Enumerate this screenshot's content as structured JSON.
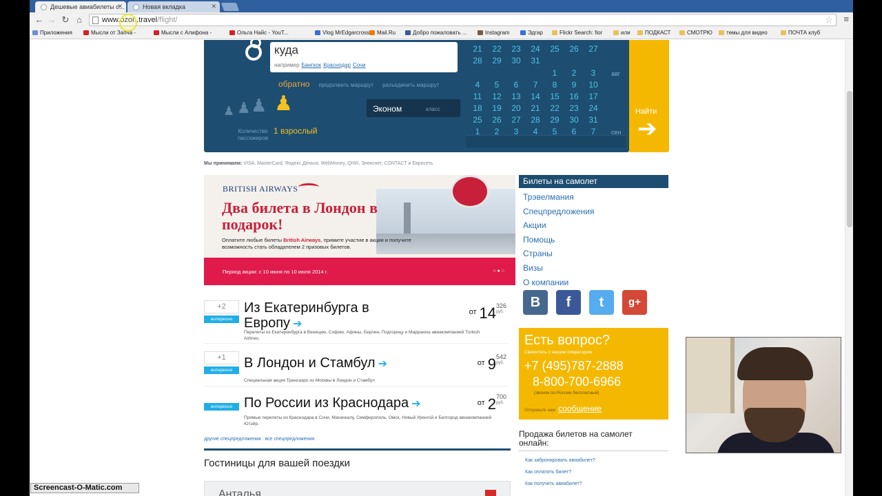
{
  "browser": {
    "tabs": [
      {
        "title": "Дешевые авиабилеты о...",
        "active": true
      },
      {
        "title": "Новая вкладка",
        "active": false
      }
    ],
    "url_host": "www.ozon.travel",
    "url_path": "/flight/",
    "bookmarks": [
      {
        "label": "Приложения",
        "icon": "apps"
      },
      {
        "label": "Мысли от Запча -",
        "icon": "yt"
      },
      {
        "label": "Мысли с Алифона -",
        "icon": "yt"
      },
      {
        "label": "Ольга Найс - YouT...",
        "icon": "yt"
      },
      {
        "label": "Vlog MrEdgarcross",
        "icon": "blue"
      },
      {
        "label": "Mail.Ru",
        "icon": "mail"
      },
      {
        "label": "Добро пожаловать ...",
        "icon": "fb"
      },
      {
        "label": "Instagram",
        "icon": "ig"
      },
      {
        "label": "Эдгар",
        "icon": "blue"
      },
      {
        "label": "Flickr Search: fior",
        "icon": "folder"
      },
      {
        "label": "или",
        "icon": "folder"
      },
      {
        "label": "ПОДКАСТ",
        "icon": "folder"
      },
      {
        "label": "СМОТРЮ",
        "icon": "folder"
      },
      {
        "label": "темы для видео",
        "icon": "folder"
      },
      {
        "label": "ПОЧТА клуб",
        "icon": "folder"
      }
    ]
  },
  "search": {
    "destination_placeholder": "куда",
    "hint_prefix": "например",
    "hint_examples": [
      "Бангкок",
      "Краснодар",
      "Сочи"
    ],
    "return_label": "обратно",
    "extend_route": "продолжить маршрут",
    "split_route": "разъединить маршрут",
    "passengers_label": "Количество пассажиров",
    "passengers_count": "1 взрослый",
    "class_value": "Эконом",
    "class_label": "класс",
    "find_label": "Найти",
    "calendar": {
      "rows": [
        [
          "21",
          "22",
          "23",
          "24",
          "25",
          "26",
          "27"
        ],
        [
          "28",
          "29",
          "30",
          "31",
          "",
          "",
          ""
        ],
        [
          "",
          "",
          "",
          "",
          "1",
          "2",
          "3"
        ],
        [
          "4",
          "5",
          "6",
          "7",
          "8",
          "9",
          "10"
        ],
        [
          "11",
          "12",
          "13",
          "14",
          "15",
          "16",
          "17"
        ],
        [
          "18",
          "19",
          "20",
          "21",
          "22",
          "23",
          "24"
        ],
        [
          "25",
          "26",
          "27",
          "28",
          "29",
          "30",
          "31"
        ],
        [
          "1",
          "2",
          "3",
          "4",
          "5",
          "6",
          "7"
        ]
      ],
      "months": [
        "авг",
        "сен"
      ]
    }
  },
  "payment_line": {
    "prefix": "Мы принимаем:",
    "text": "VISA, MasterCard, Яндекс.Деньги, WebMoney, QIWI, Элекснет, CONTACT и Евросеть"
  },
  "banner": {
    "brand": "BRITISH AIRWAYS",
    "headline": "Два билета в Лондон в подарок!",
    "text_before": "Оплатите любые билеты",
    "text_brand": "British Airways",
    "text_after": ", примите участие в акции и получите возможность стать обладателем 2 призовых билетов.",
    "period": "Период акции: с 10 июня по 10 июля 2014 г.",
    "dots": "○●○"
  },
  "offers": [
    {
      "count": "+2",
      "tag": "интересно",
      "title": "Из Екатеринбурга в Европу",
      "price_from": "от",
      "price_big": "14",
      "price_small": "326",
      "currency": "руб.",
      "desc": "Перелеты из Екатеринбурга в Венецию, Софию, Афины, Берлин, Подгорицу и Марракеш авиакомпанией Turkish Airlines."
    },
    {
      "count": "+1",
      "tag": "интересно",
      "title": "В Лондон и Стамбул",
      "price_from": "от",
      "price_big": "9",
      "price_small": "542",
      "currency": "руб.",
      "desc": "Специальная акция Трансаэро из Москвы в Лондон и Стамбул"
    },
    {
      "count": "",
      "tag": "интересно",
      "title": "По России из Краснодара",
      "price_from": "от",
      "price_big": "2",
      "price_small": "700",
      "currency": "руб.",
      "desc": "Прямые перелеты из Краснодара в Сочи, Махачкалу, Симферополь, Омск, Новый Уренгой и Белгород авиакомпанией Ютэйр."
    }
  ],
  "more_offers": "другие спецпредложения : все спецпредложения",
  "hotels": {
    "title": "Гостиницы для вашей поездки",
    "input_placeholder": "Анталья"
  },
  "sidebar": {
    "header": "Билеты на самолет",
    "links": [
      "Трэвелмания",
      "Спецпредложения",
      "Акции",
      "Помощь",
      "Страны",
      "Визы",
      "О компании"
    ],
    "social": [
      {
        "name": "vk",
        "glyph": "B"
      },
      {
        "name": "facebook",
        "glyph": "f"
      },
      {
        "name": "twitter",
        "glyph": "t"
      },
      {
        "name": "google-plus",
        "glyph": "g+"
      }
    ]
  },
  "question": {
    "title": "Есть вопрос?",
    "subtitle": "Свяжитесь с нашим оператором",
    "phone1": "+7 (495)787-2888",
    "phone2": "8-800-700-6966",
    "free_note": "(звонок по России бесплатный)",
    "msg_prefix": "Отправьте нам",
    "msg_link": "сообщение"
  },
  "sales": {
    "title": "Продажа билетов на самолет онлайн:",
    "faq": [
      "Как забронировать авиабилет?",
      "Как оплатить билет?",
      "Как получить авиабилет?"
    ]
  },
  "watermark": "Screencast-O-Matic.com"
}
